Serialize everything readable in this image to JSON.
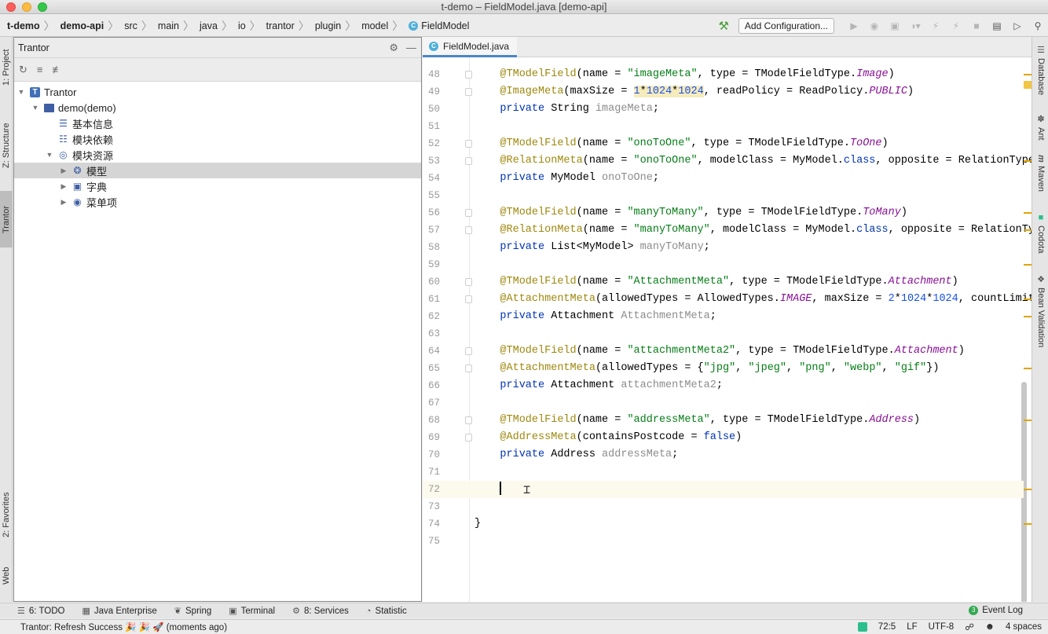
{
  "window": {
    "title": "t-demo – FieldModel.java [demo-api]"
  },
  "breadcrumbs": [
    {
      "label": "t-demo",
      "bold": true
    },
    {
      "label": "demo-api",
      "bold": true
    },
    {
      "label": "src"
    },
    {
      "label": "main"
    },
    {
      "label": "java"
    },
    {
      "label": "io"
    },
    {
      "label": "trantor"
    },
    {
      "label": "plugin"
    },
    {
      "label": "model"
    },
    {
      "label": "FieldModel",
      "icon": "class-icon"
    }
  ],
  "toolbar": {
    "add_config_label": "Add Configuration..."
  },
  "left_tabs": {
    "project": "1: Project",
    "structure": "Z: Structure",
    "trantor": "Trantor",
    "favorites": "2: Favorites",
    "web": "Web"
  },
  "right_tabs": {
    "database": "Database",
    "ant": "Ant",
    "maven": "Maven",
    "codota": "Codota",
    "bean_validation": "Bean Validation"
  },
  "project_panel": {
    "title": "Trantor",
    "tree": [
      {
        "label": "Trantor",
        "level": 0,
        "expanded": true,
        "icon": "trantor-icon"
      },
      {
        "label": "demo(demo)",
        "level": 1,
        "expanded": true,
        "icon": "folder-icon"
      },
      {
        "label": "基本信息",
        "level": 2,
        "icon": "info-icon"
      },
      {
        "label": "模块依赖",
        "level": 2,
        "icon": "hierarchy-icon"
      },
      {
        "label": "模块资源",
        "level": 2,
        "expanded": true,
        "icon": "globe-icon"
      },
      {
        "label": "模型",
        "level": 3,
        "collapsed": true,
        "icon": "model-icon",
        "selected": true
      },
      {
        "label": "字典",
        "level": 3,
        "collapsed": true,
        "icon": "dictionary-icon"
      },
      {
        "label": "菜单项",
        "level": 3,
        "collapsed": true,
        "icon": "menu-icon"
      }
    ]
  },
  "editor": {
    "tab_label": "FieldModel.java",
    "current_line": 72,
    "lines": [
      {
        "n": 48,
        "fold": true,
        "html": "    <span class='a'>@TModelField</span>(name = <span class='s'>\"imageMeta\"</span>, type = TModelFieldType.<span class='i'>Image</span>)"
      },
      {
        "n": 49,
        "fold": true,
        "html": "    <span class='a'>@ImageMeta</span>(maxSize = <span class='n hl'>1</span><span class='hl'>*</span><span class='n hl'>1024</span><span class='hl'>*</span><span class='n hl'>1024</span>, readPolicy = ReadPolicy.<span class='i'>PUBLIC</span>)"
      },
      {
        "n": 50,
        "html": "    <span class='k'>private</span> String <span class='f'>imageMeta</span>;"
      },
      {
        "n": 51,
        "html": ""
      },
      {
        "n": 52,
        "fold": true,
        "html": "    <span class='a'>@TModelField</span>(name = <span class='s'>\"onoToOne\"</span>, type = TModelFieldType.<span class='i'>ToOne</span>)"
      },
      {
        "n": 53,
        "fold": true,
        "html": "    <span class='a'>@RelationMeta</span>(name = <span class='s'>\"onoToOne\"</span>, modelClass = MyModel.<span class='k'>class</span>, opposite = RelationType."
      },
      {
        "n": 54,
        "html": "    <span class='k'>private</span> MyModel <span class='f'>onoToOne</span>;"
      },
      {
        "n": 55,
        "html": ""
      },
      {
        "n": 56,
        "fold": true,
        "html": "    <span class='a'>@TModelField</span>(name = <span class='s'>\"manyToMany\"</span>, type = TModelFieldType.<span class='i'>ToMany</span>)"
      },
      {
        "n": 57,
        "fold": true,
        "html": "    <span class='a'>@RelationMeta</span>(name = <span class='s'>\"manyToMany\"</span>, modelClass = MyModel.<span class='k'>class</span>, opposite = RelationTyp"
      },
      {
        "n": 58,
        "html": "    <span class='k'>private</span> List&lt;MyModel&gt; <span class='f'>manyToMany</span>;"
      },
      {
        "n": 59,
        "html": ""
      },
      {
        "n": 60,
        "fold": true,
        "html": "    <span class='a'>@TModelField</span>(name = <span class='s'>\"AttachmentMeta\"</span>, type = TModelFieldType.<span class='i'>Attachment</span>)"
      },
      {
        "n": 61,
        "fold": true,
        "html": "    <span class='a'>@AttachmentMeta</span>(allowedTypes = AllowedTypes.<span class='i'>IMAGE</span>, maxSize = <span class='n'>2</span>*<span class='n'>1024</span>*<span class='n'>1024</span>, countLimit"
      },
      {
        "n": 62,
        "html": "    <span class='k'>private</span> Attachment <span class='f'>AttachmentMeta</span>;"
      },
      {
        "n": 63,
        "html": ""
      },
      {
        "n": 64,
        "fold": true,
        "html": "    <span class='a'>@TModelField</span>(name = <span class='s'>\"attachmentMeta2\"</span>, type = TModelFieldType.<span class='i'>Attachment</span>)"
      },
      {
        "n": 65,
        "fold": true,
        "html": "    <span class='a'>@AttachmentMeta</span>(allowedTypes = {<span class='s'>\"jpg\"</span>, <span class='s'>\"jpeg\"</span>, <span class='s'>\"png\"</span>, <span class='s'>\"webp\"</span>, <span class='s'>\"gif\"</span>})"
      },
      {
        "n": 66,
        "html": "    <span class='k'>private</span> Attachment <span class='f'>attachmentMeta2</span>;"
      },
      {
        "n": 67,
        "html": ""
      },
      {
        "n": 68,
        "fold": true,
        "html": "    <span class='a'>@TModelField</span>(name = <span class='s'>\"addressMeta\"</span>, type = TModelFieldType.<span class='i'>Address</span>)"
      },
      {
        "n": 69,
        "fold": true,
        "html": "    <span class='a'>@AddressMeta</span>(containsPostcode = <span class='k'>false</span>)"
      },
      {
        "n": 70,
        "html": "    <span class='k'>private</span> Address <span class='f'>addressMeta</span>;"
      },
      {
        "n": 71,
        "html": ""
      },
      {
        "n": 72,
        "html": "    <span class='caret'></span>"
      },
      {
        "n": 73,
        "html": ""
      },
      {
        "n": 74,
        "html": "}"
      },
      {
        "n": 75,
        "html": ""
      }
    ]
  },
  "bottom_tabs": [
    {
      "label": "6: TODO",
      "icon": "list-icon"
    },
    {
      "label": "Java Enterprise",
      "icon": "enterprise-icon"
    },
    {
      "label": "Spring",
      "icon": "spring-icon"
    },
    {
      "label": "Terminal",
      "icon": "terminal-icon"
    },
    {
      "label": "8: Services",
      "icon": "services-icon"
    },
    {
      "label": "Statistic",
      "icon": "statistic-icon"
    }
  ],
  "event_log": {
    "label": "Event Log",
    "count": "3"
  },
  "status": {
    "message": "Trantor: Refresh Success 🎉 🎉 🚀 (moments ago)",
    "position": "72:5",
    "line_sep": "LF",
    "encoding": "UTF-8",
    "indent": "4 spaces"
  },
  "colors": {
    "accent": "#4a86c8",
    "annotation": "#9e880d",
    "string": "#067d17",
    "keyword": "#0033b3"
  }
}
